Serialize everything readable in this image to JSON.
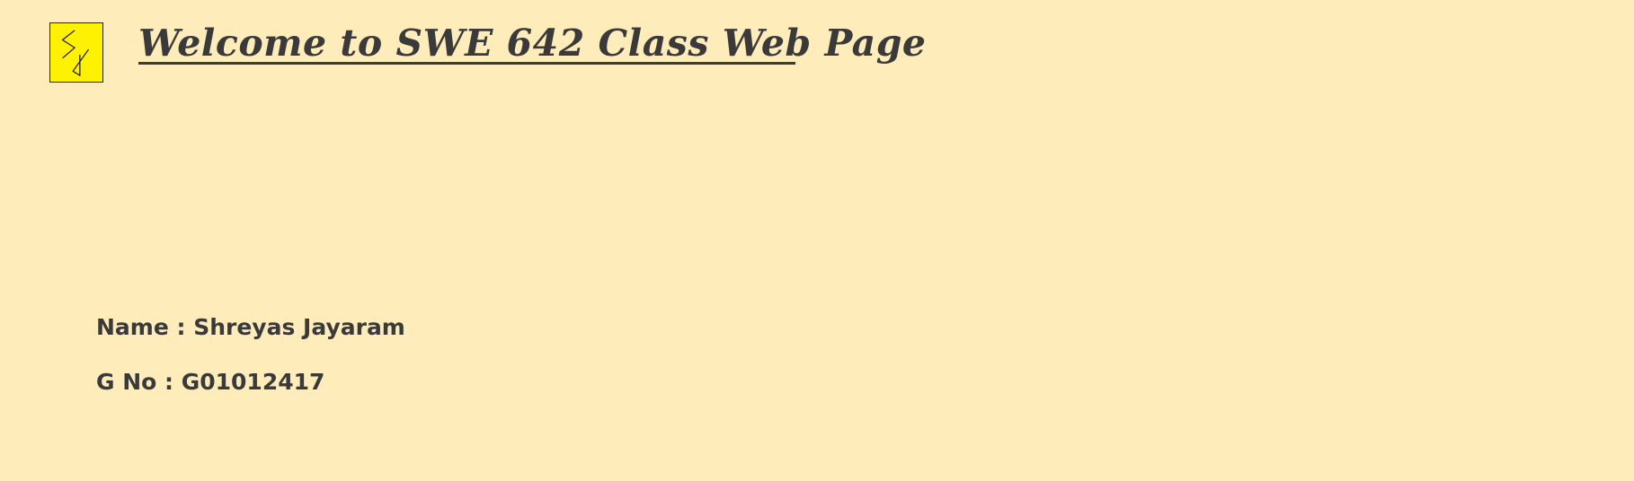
{
  "header": {
    "logo_icon": "sj-monogram-icon",
    "logo_color": "#fff200",
    "title": "Welcome to SWE 642 Class Web Page"
  },
  "student": {
    "name_line": "Name : Shreyas Jayaram",
    "gno_line": "G No : G01012417"
  },
  "colors": {
    "background": "#feedbb",
    "text": "#3a3a3a"
  }
}
